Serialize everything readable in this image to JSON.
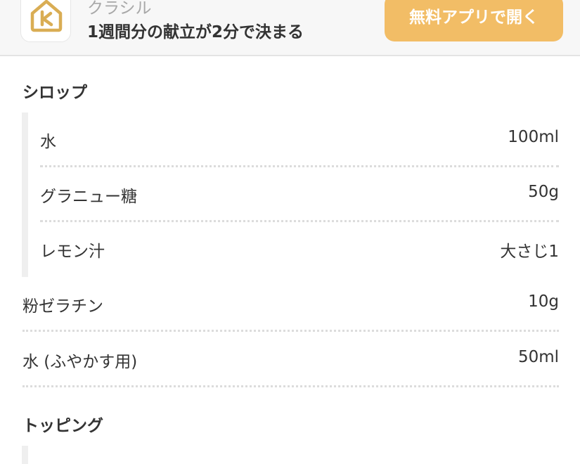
{
  "banner": {
    "app_icon": "kurashiru-house-logo-icon",
    "app_name": "クラシル",
    "tagline": "1週間分の献立が2分で決まる",
    "open_button_label": "無料アプリで開く",
    "accent_color": "#f2bd66"
  },
  "sections": {
    "syrup": {
      "title": "シロップ",
      "items": [
        {
          "name": "水",
          "amount": "100ml"
        },
        {
          "name": "グラニュー糖",
          "amount": "50g"
        },
        {
          "name": "レモン汁",
          "amount": "大さじ1"
        }
      ]
    },
    "main_items": [
      {
        "name": "粉ゼラチン",
        "amount": "10g"
      },
      {
        "name": "水 (ふやかす用)",
        "amount": "50ml"
      }
    ],
    "topping": {
      "title": "トッピング"
    }
  }
}
